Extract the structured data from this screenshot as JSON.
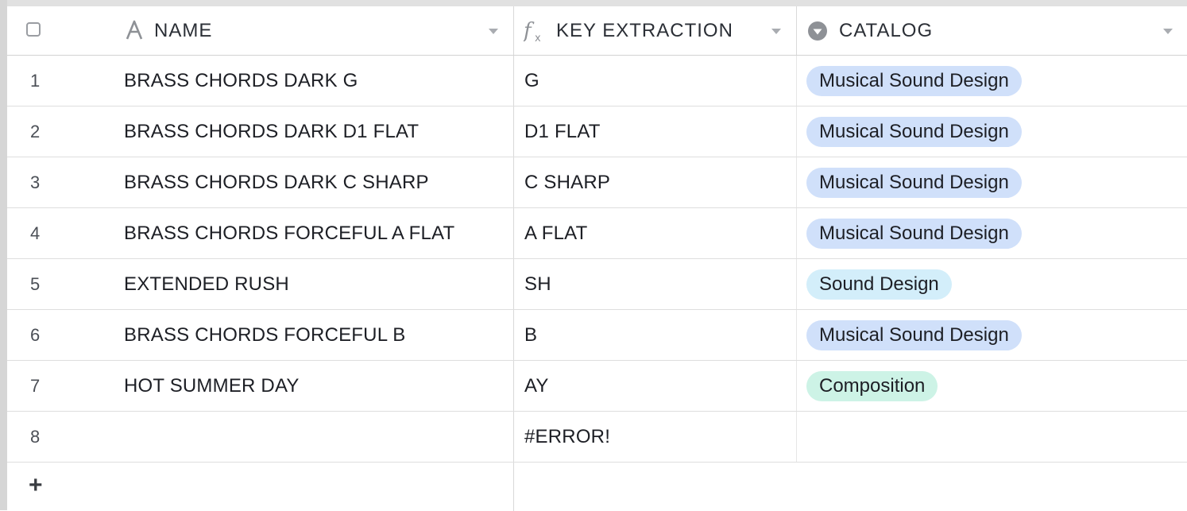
{
  "header": {
    "name_label": "NAME",
    "key_label": "KEY EXTRACTION",
    "catalog_label": "CATALOG",
    "name_icon": "text-field-icon",
    "key_icon": "formula-icon",
    "catalog_icon": "single-select-icon"
  },
  "rows": [
    {
      "num": "1",
      "name": "BRASS CHORDS DARK G",
      "key": "G",
      "catalog": "Musical Sound Design",
      "catalog_color": "#d0e0fa"
    },
    {
      "num": "2",
      "name": "BRASS CHORDS DARK D1 FLAT",
      "key": "D1 FLAT",
      "catalog": "Musical Sound Design",
      "catalog_color": "#d0e0fa"
    },
    {
      "num": "3",
      "name": "BRASS CHORDS DARK C SHARP",
      "key": "C SHARP",
      "catalog": "Musical Sound Design",
      "catalog_color": "#d0e0fa"
    },
    {
      "num": "4",
      "name": "BRASS CHORDS FORCEFUL A FLAT",
      "key": "A FLAT",
      "catalog": "Musical Sound Design",
      "catalog_color": "#d0e0fa"
    },
    {
      "num": "5",
      "name": "EXTENDED RUSH",
      "key": "SH",
      "catalog": "Sound Design",
      "catalog_color": "#d3eefa"
    },
    {
      "num": "6",
      "name": "BRASS CHORDS FORCEFUL B",
      "key": "B",
      "catalog": "Musical Sound Design",
      "catalog_color": "#d0e0fa"
    },
    {
      "num": "7",
      "name": "HOT SUMMER DAY",
      "key": "AY",
      "catalog": "Composition",
      "catalog_color": "#cdf3e6"
    },
    {
      "num": "8",
      "name": "",
      "key": "#ERROR!",
      "catalog": "",
      "catalog_color": ""
    }
  ],
  "footer": {
    "add_label": "+"
  }
}
